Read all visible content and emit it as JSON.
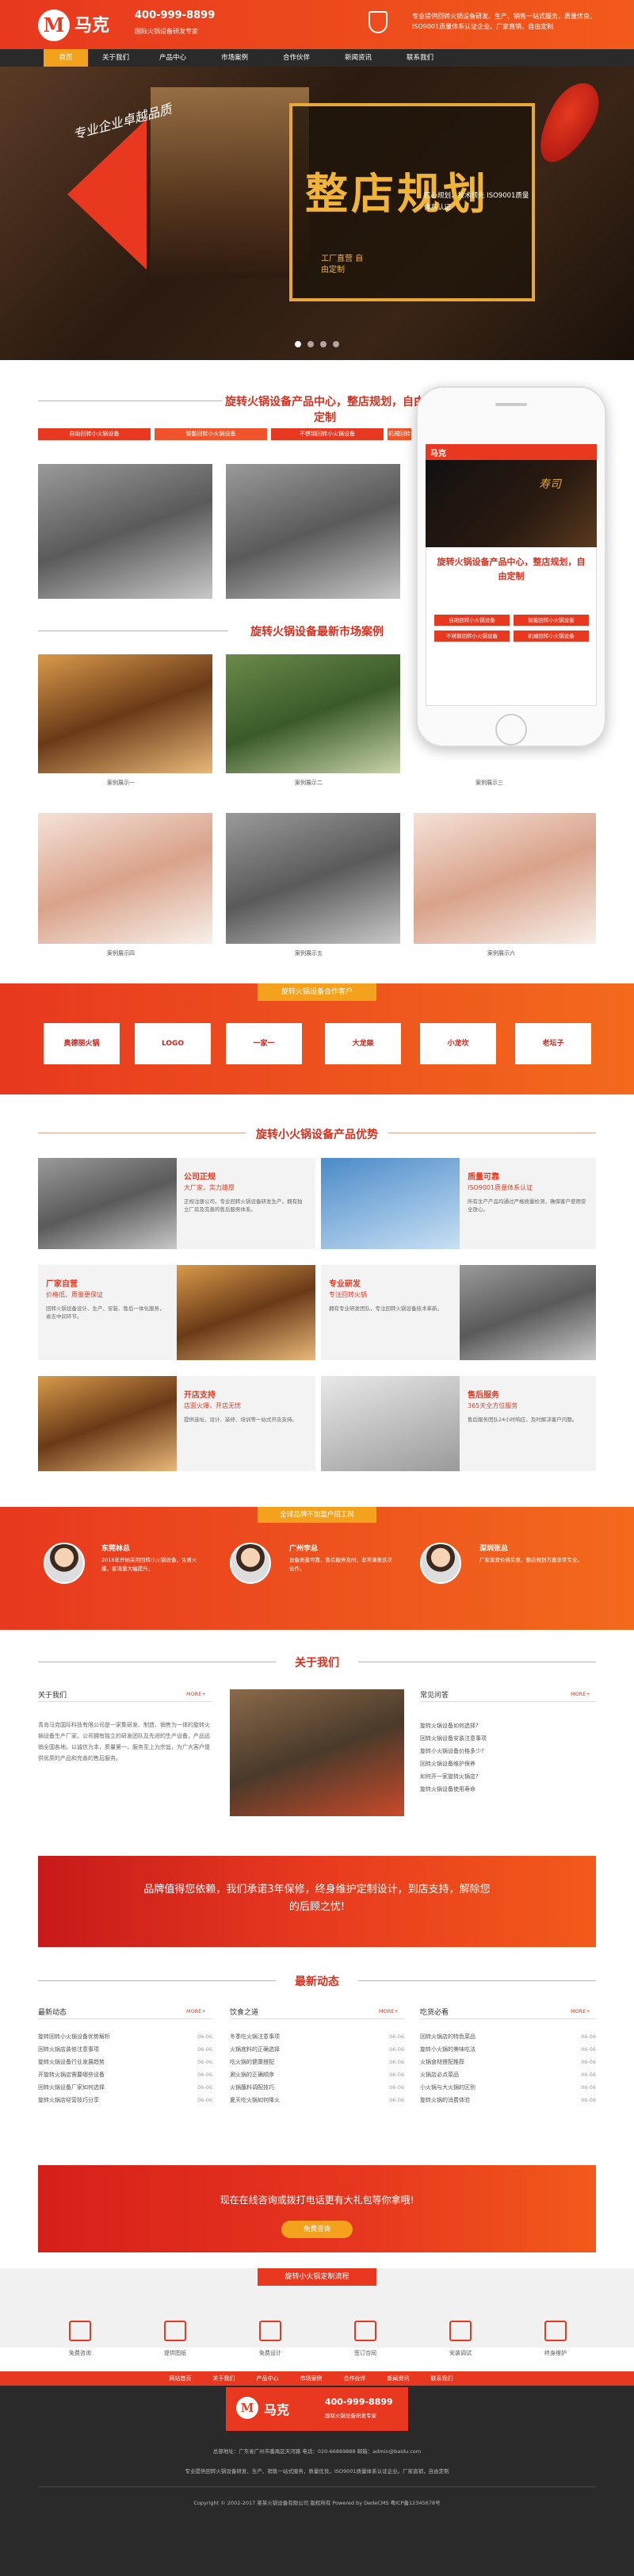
{
  "colors": {
    "brand": "#e8381f",
    "accent": "#f4a11d",
    "dark": "#2a2a2a"
  },
  "header": {
    "logo_glyph": "M",
    "logo_text": "马克",
    "phone": "400-999-8899",
    "phone_sub": "国际火锅设备研发专家",
    "desc": "专业提供回转火锅设备研发、生产、销售一站式服务，质量优良，ISO9001质量体系认证企业。厂家直销，自由定制"
  },
  "nav": [
    "首页",
    "关于我们",
    "产品中心",
    "市场案例",
    "合作伙伴",
    "新闻资讯",
    "联系我们"
  ],
  "banner": {
    "slogan": "专业企业卓越品质",
    "big": "整店规划",
    "sub": "工厂直营 自由定制",
    "points": "匠心规划，技术领先 ISO9001质量体系认证"
  },
  "products": {
    "title": "旋转火锅设备产品中心，整店规划，自由定制",
    "tabs": [
      "自助回转小火锅设备",
      "智能回转小火锅设备",
      "不锈钢回转小火锅设备",
      "机械回转小火锅设备"
    ]
  },
  "cases": {
    "title": "旋转火锅设备最新市场案例",
    "items": [
      "案例展示一",
      "案例展示二",
      "案例展示三",
      "案例展示四",
      "案例展示五",
      "案例展示六"
    ]
  },
  "phone_mock": {
    "logo": "马克",
    "hero": "寿司",
    "title": "旋转火锅设备产品中心，整店规划，自由定制",
    "tabs": [
      "自助回转小火锅设备",
      "智能回转小火锅设备",
      "不锈钢回转小火锅设备",
      "机械回转小火锅设备"
    ]
  },
  "partners": {
    "title": "旋转火锅设备合作客户",
    "logos": [
      "奥德丽火锅",
      "LOGO",
      "一家一",
      "大龙燚",
      "小龙坎",
      "老坛子"
    ]
  },
  "advantages": {
    "title": "旋转小火锅设备产品优势",
    "items": [
      {
        "title": "公司正规",
        "sub": "大厂家，实力雄厚",
        "text": "正规注册公司，专业回转火锅设备研发生产，拥有独立厂房及完善的售后服务体系。"
      },
      {
        "title": "质量可靠",
        "sub": "ISO9001质量体系认证",
        "text": "所有生产产品均通过严格质量检测，确保客户使用安全放心。"
      },
      {
        "title": "厂家自营",
        "sub": "价格低、质量更保证",
        "text": "回转火锅设备设计、生产、安装、售后一体化服务，省去中间环节。"
      },
      {
        "title": "专业研发",
        "sub": "专注回转火锅",
        "text": "拥有专业研发团队，专注回转火锅设备技术革新。"
      },
      {
        "title": "开店支持",
        "sub": "店面火爆，开店无忧",
        "text": "提供选址、设计、装修、培训等一站式开店支持。"
      },
      {
        "title": "售后服务",
        "sub": "365天全方位服务",
        "text": "售后服务团队24小时响应，及时解决客户问题。"
      }
    ]
  },
  "testimonials": {
    "title": "全球品牌不加盟户招工网",
    "items": [
      {
        "name": "东莞林总",
        "text": "2018年开始采用回转小火锅设备，生意火爆，客流量大幅提升。"
      },
      {
        "name": "广州李总",
        "text": "设备质量可靠，售后服务及时，非常满意这次合作。"
      },
      {
        "name": "深圳张总",
        "text": "厂家直营价格实惠，整店规划方案非常专业。"
      }
    ]
  },
  "about": {
    "title": "关于我们",
    "col1_head": "关于我们",
    "more": "MORE+",
    "intro": "青岛马克国际科技有限公司是一家集研发、制造、销售为一体的旋转火锅设备生产厂家，公司拥有独立的研发团队及先进的生产设备，产品远销全国各地。以诚信为本，质量第一，服务至上为宗旨，为广大客户提供优质的产品和完善的售后服务。",
    "col3_head": "常见问答",
    "faq": [
      "旋转火锅设备如何选择?",
      "回转火锅设备安装注意事项",
      "旋转小火锅设备价格多少?",
      "回转火锅设备维护保养",
      "如何开一家旋转火锅店?",
      "旋转火锅设备使用寿命"
    ]
  },
  "promo": {
    "text": "品牌值得您依赖，我们承诺3年保修，终身维护定制设计，到店支持，解除您的后顾之忧!"
  },
  "news": {
    "title": "最新动态",
    "cols": [
      {
        "head": "最新动态",
        "items": [
          "旋转回转小火锅设备优势解析",
          "回转火锅店装修注意事项",
          "旋转火锅设备行业发展趋势",
          "开旋转火锅店需要哪些设备",
          "回转火锅设备厂家如何选择",
          "旋转火锅店经营技巧分享"
        ],
        "dates": [
          "06-06",
          "06-06",
          "06-06",
          "06-06",
          "06-06",
          "06-06"
        ]
      },
      {
        "head": "饮食之道",
        "items": [
          "冬季吃火锅注意事项",
          "火锅底料的正确选择",
          "吃火锅的健康搭配",
          "涮火锅的正确顺序",
          "火锅蘸料调配技巧",
          "夏天吃火锅如何降火"
        ],
        "dates": [
          "06-06",
          "06-06",
          "06-06",
          "06-06",
          "06-06",
          "06-06"
        ]
      },
      {
        "head": "吃货必看",
        "items": [
          "回转火锅店的特色菜品",
          "旋转小火锅的美味吃法",
          "火锅食材搭配推荐",
          "火锅店必点菜品",
          "小火锅与大火锅的区别",
          "旋转火锅的消费体验"
        ],
        "dates": [
          "06-06",
          "06-06",
          "06-06",
          "06-06",
          "06-06",
          "06-06"
        ]
      }
    ]
  },
  "cta": {
    "text": "现在在线咨询或拨打电话更有大礼包等你拿哦!",
    "button": "免费咨询"
  },
  "process": {
    "title": "旋转小火锅定制流程",
    "steps": [
      "免费咨询",
      "提供图纸",
      "免费设计",
      "签订合同",
      "安装调试",
      "终身维护"
    ]
  },
  "footer": {
    "nav": [
      "网站首页",
      "关于我们",
      "产品中心",
      "市场案例",
      "合作伙伴",
      "新闻资讯",
      "联系我们"
    ],
    "logo_glyph": "M",
    "logo_name": "马克",
    "phone": "400-999-8899",
    "phone_sub": "国际火锅设备研发专家",
    "contact": "总部地址：广东省广州市番禺区天河路 电话：020-66889888 邮箱：admin@baidu.com",
    "desc": "专业提供回转火锅设备研发、生产、销售一站式服务，质量优良，ISO9001质量体系认证企业。厂家直销，自由定制",
    "copyright": "Copyright © 2002-2017 某某火锅设备有限公司 版权所有 Powered by DedeCMS 粤ICP备12345678号"
  }
}
